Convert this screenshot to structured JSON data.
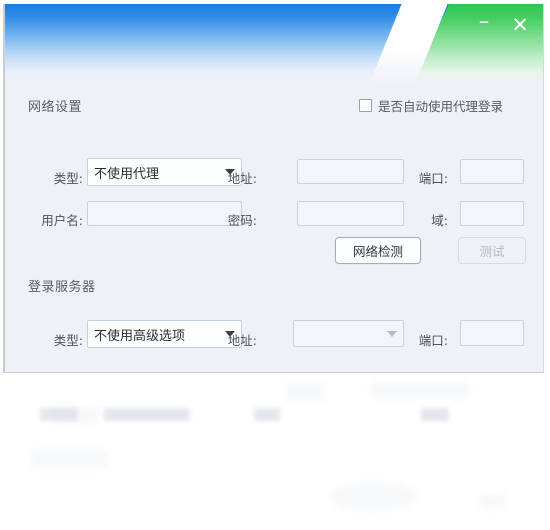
{
  "window": {
    "controls": [
      {
        "name": "minimize",
        "glyph": "–"
      },
      {
        "name": "close",
        "glyph": "✕"
      }
    ],
    "accent_blue": "#1a7ce4",
    "accent_green": "#2ec64f"
  },
  "network_section": {
    "title": "网络设置",
    "auto_proxy_checkbox": {
      "label": "是否自动使用代理登录",
      "checked": false
    },
    "type": {
      "label": "类型:",
      "value": "不使用代理"
    },
    "address": {
      "label": "地址:",
      "value": "",
      "placeholder": ""
    },
    "port": {
      "label": "端口:",
      "value": "",
      "placeholder": ""
    },
    "username": {
      "label": "用户名:",
      "value": "",
      "placeholder": ""
    },
    "password": {
      "label": "密码:",
      "value": "",
      "placeholder": ""
    },
    "domain": {
      "label": "域:",
      "value": "",
      "placeholder": ""
    },
    "detect_button": {
      "label": "网络检测",
      "enabled": true
    },
    "test_button": {
      "label": "测试",
      "enabled": false
    }
  },
  "login_server_section": {
    "title": "登录服务器",
    "type": {
      "label": "类型:",
      "value": "不使用高级选项"
    },
    "address": {
      "label": "地址:",
      "value": "",
      "placeholder": ""
    },
    "port": {
      "label": "端口:",
      "value": "",
      "placeholder": ""
    }
  }
}
